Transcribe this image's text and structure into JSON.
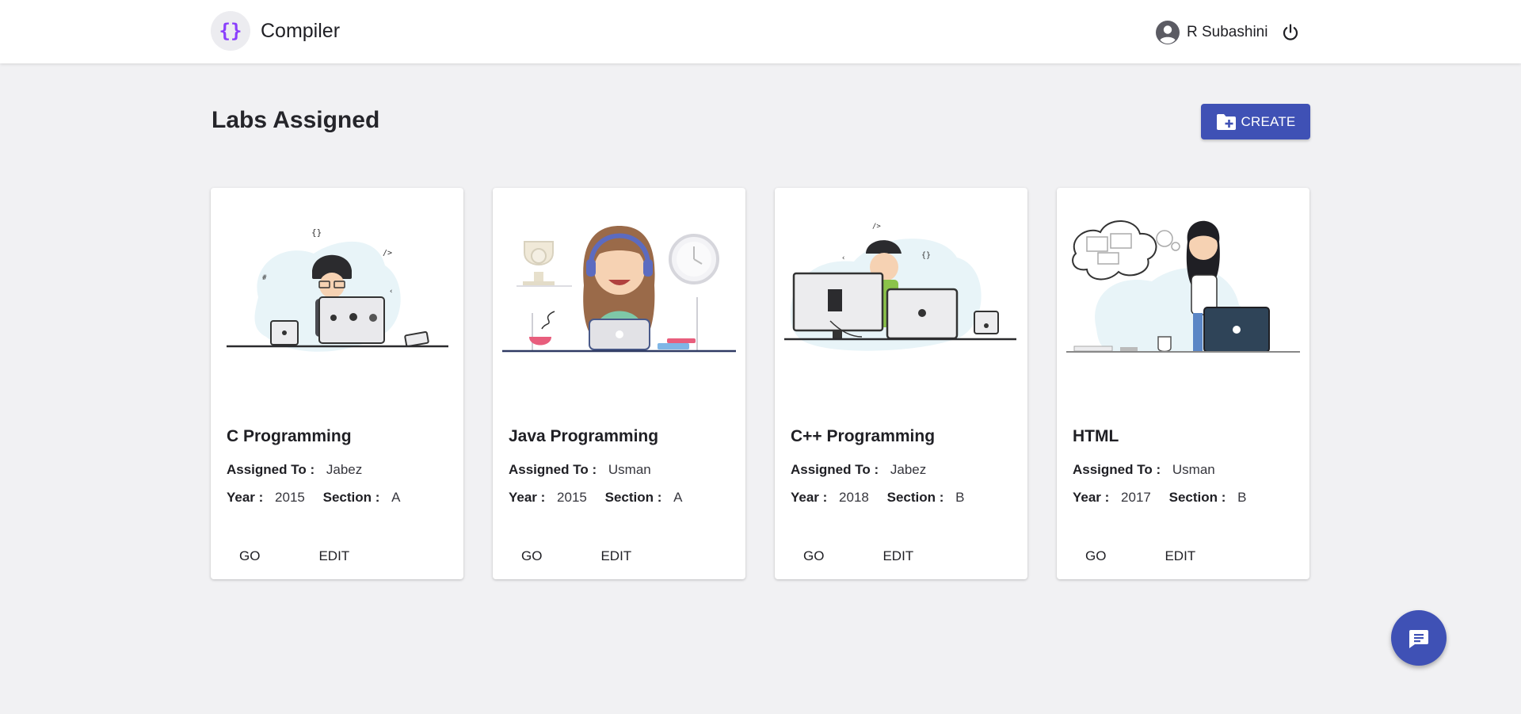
{
  "header": {
    "logo_glyph": "{}",
    "app_name": "Compiler",
    "user_name": "R Subashini",
    "user_icon": "account-circle-icon",
    "logout_icon": "power-icon"
  },
  "page": {
    "title": "Labs Assigned",
    "create_label": "CREATE",
    "create_icon": "folder-plus-icon"
  },
  "labels": {
    "assigned_to": "Assigned To :",
    "year": "Year :",
    "section": "Section :",
    "go": "GO",
    "edit": "EDIT"
  },
  "labs": [
    {
      "title": "C Programming",
      "assigned_to": "Jabez",
      "year": "2015",
      "section": "A",
      "illustration": "developer-with-laptop-illustration"
    },
    {
      "title": "Java Programming",
      "assigned_to": "Usman",
      "year": "2015",
      "section": "A",
      "illustration": "support-agent-with-headset-illustration"
    },
    {
      "title": "C++ Programming",
      "assigned_to": "Jabez",
      "year": "2018",
      "section": "B",
      "illustration": "developer-behind-monitor-illustration"
    },
    {
      "title": "HTML",
      "assigned_to": "Usman",
      "year": "2017",
      "section": "B",
      "illustration": "woman-thinking-with-laptop-illustration"
    }
  ],
  "fab": {
    "icon": "chat-icon"
  },
  "colors": {
    "primary": "#3f51b5",
    "background": "#f1f1f3",
    "logo_accent": "#8a3ffc",
    "card": "#ffffff"
  }
}
